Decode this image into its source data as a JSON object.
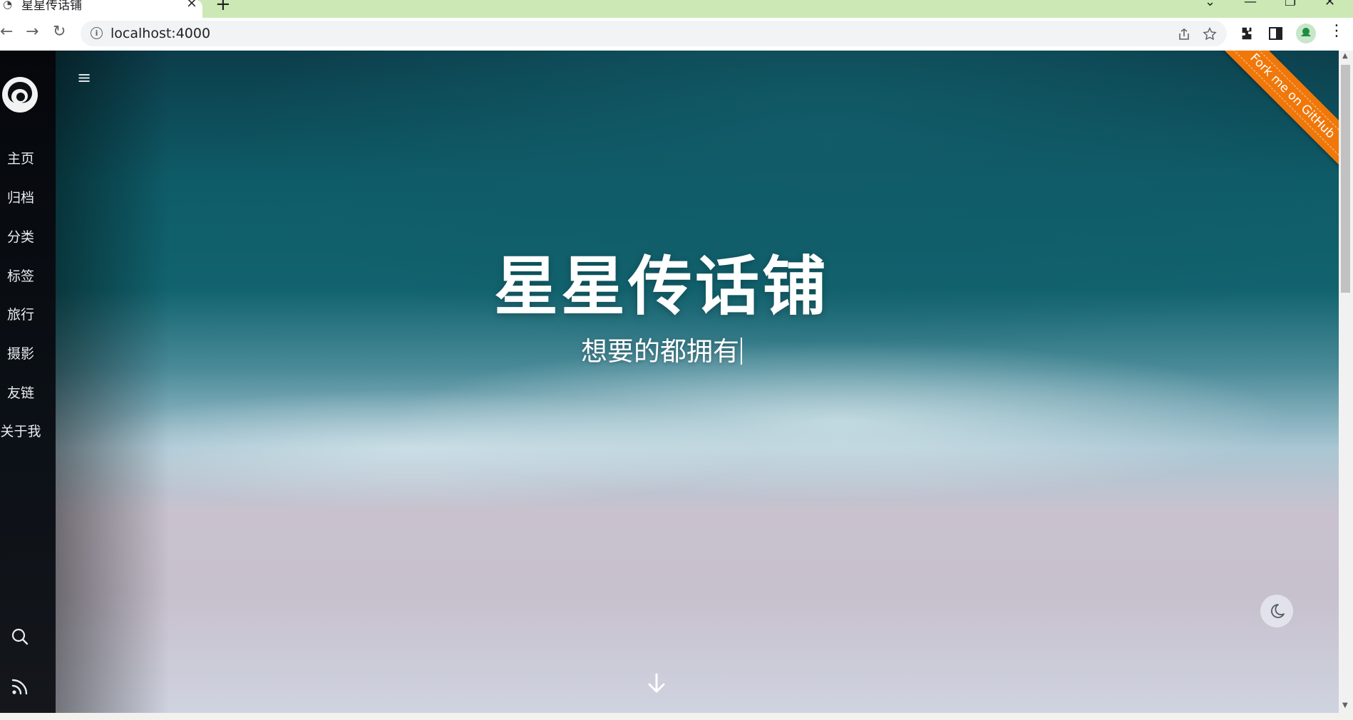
{
  "browser": {
    "tab_title": "星星传话铺",
    "tab_close": "×",
    "new_tab": "+",
    "url": "localhost:4000",
    "controls": {
      "minimize": "—",
      "restore": "❐",
      "close": "✕",
      "tab_search": "⌄"
    },
    "nav": {
      "back": "←",
      "forward": "→",
      "reload": "↻"
    },
    "icons": [
      "share-icon",
      "star-icon",
      "extensions-icon",
      "sidepanel-icon",
      "profile-icon",
      "menu-icon"
    ]
  },
  "sidebar": {
    "items": [
      {
        "label": "主页"
      },
      {
        "label": "归档"
      },
      {
        "label": "分类"
      },
      {
        "label": "标签"
      },
      {
        "label": "旅行"
      },
      {
        "label": "摄影"
      },
      {
        "label": "友链"
      },
      {
        "label": "关于我"
      }
    ],
    "bottom_icons": [
      "search-icon",
      "rss-icon"
    ]
  },
  "hero": {
    "title": "星星传话铺",
    "subtitle": "想要的都拥有",
    "menu_glyph": "≡",
    "ribbon_text": "Fork me on GitHub",
    "ribbon_color": "#f0780a"
  }
}
